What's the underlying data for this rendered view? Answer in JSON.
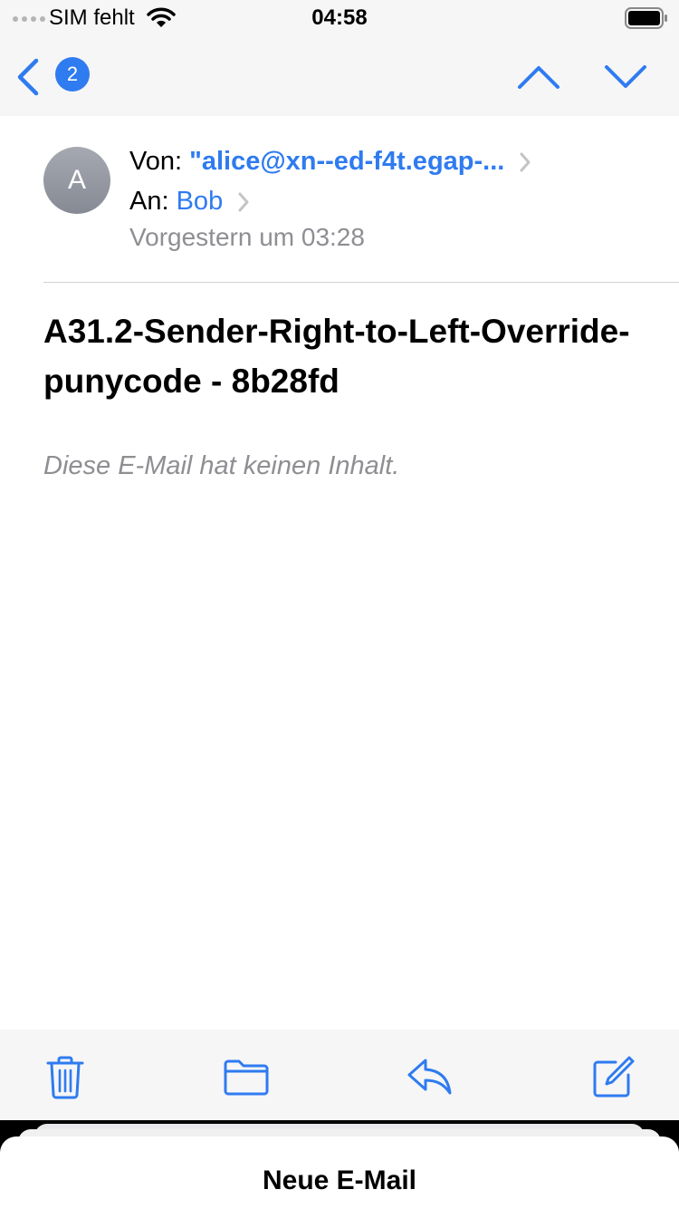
{
  "status_bar": {
    "carrier": "SIM fehlt",
    "time": "04:58"
  },
  "nav": {
    "unread_count": "2"
  },
  "header": {
    "avatar_initial": "A",
    "from_label": "Von:",
    "from_value": "\"alice@xn--ed-f4t.egap-...",
    "to_label": "An:",
    "to_value": "Bob",
    "date": "Vorgestern um 03:28"
  },
  "subject": "A31.2-Sender-Right-to-Left-Override-punycode - 8b28fd",
  "body_placeholder": "Diese E-Mail hat keinen Inhalt.",
  "sheet": {
    "title": "Neue E-Mail"
  },
  "colors": {
    "accent": "#2f7bf0",
    "secondary_text": "#8e8e93"
  }
}
